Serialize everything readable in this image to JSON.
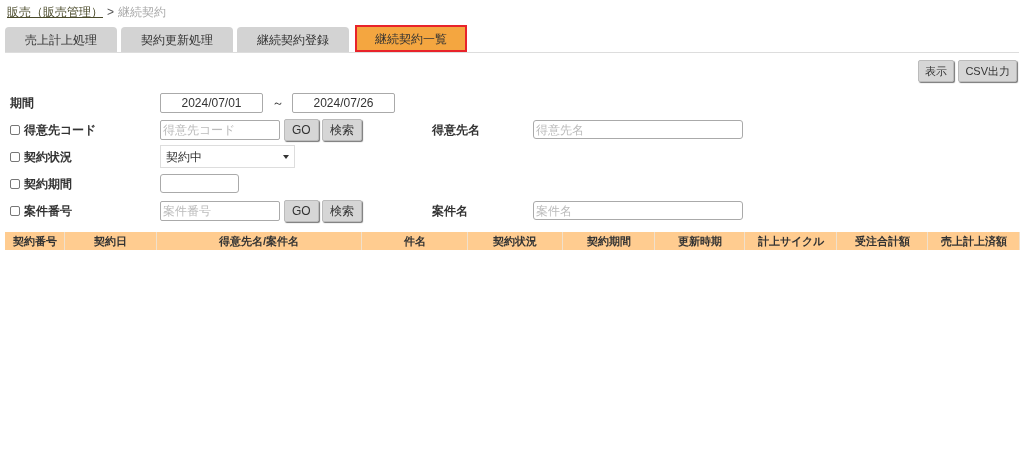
{
  "breadcrumb": {
    "link": "販売（販売管理）",
    "separator": ">",
    "current": "継続契約"
  },
  "tabs": [
    {
      "label": "売上計上処理",
      "selected": false
    },
    {
      "label": "契約更新処理",
      "selected": false
    },
    {
      "label": "継続契約登録",
      "selected": false
    },
    {
      "label": "継続契約一覧",
      "selected": true
    }
  ],
  "actions": [
    "表示",
    "CSV出力"
  ],
  "period": {
    "label": "期間",
    "from": "2024/07/01",
    "separator": "～",
    "to": "2024/07/26"
  },
  "filters": [
    {
      "kind": "lookup",
      "label": "得意先コード",
      "checked": false,
      "placeholder": "得意先コード",
      "buttons": [
        "GO",
        "検索"
      ],
      "name_label": "得意先名",
      "name_placeholder": "得意先名"
    },
    {
      "kind": "select",
      "label": "契約状況",
      "checked": false,
      "value": "契約中"
    },
    {
      "kind": "text",
      "label": "契約期間",
      "checked": false
    },
    {
      "kind": "lookup",
      "label": "案件番号",
      "checked": false,
      "placeholder": "案件番号",
      "buttons": [
        "GO",
        "検索"
      ],
      "name_label": "案件名",
      "name_placeholder": "案件名"
    }
  ],
  "table": {
    "columns": [
      "契約番号",
      "契約日",
      "得意先名/案件名",
      "件名",
      "契約状況",
      "契約期間",
      "更新時期",
      "計上サイクル",
      "受注合計額",
      "売上計上済額"
    ]
  }
}
